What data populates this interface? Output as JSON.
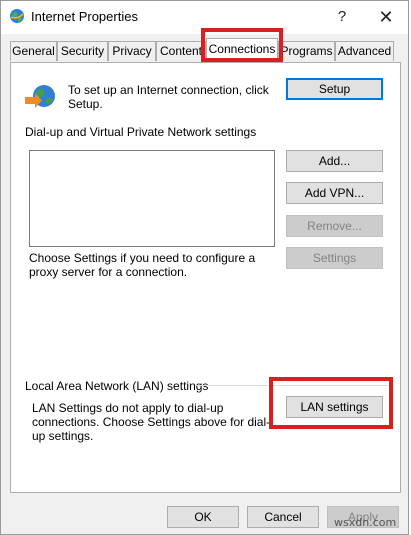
{
  "window": {
    "title": "Internet Properties",
    "help_glyph": "?",
    "close_glyph": "✕"
  },
  "tabs": [
    {
      "label": "General",
      "active": false
    },
    {
      "label": "Security",
      "active": false
    },
    {
      "label": "Privacy",
      "active": false
    },
    {
      "label": "Content",
      "active": false
    },
    {
      "label": "Connections",
      "active": true
    },
    {
      "label": "Programs",
      "active": false
    },
    {
      "label": "Advanced",
      "active": false
    }
  ],
  "setup": {
    "text": "To set up an Internet connection, click Setup.",
    "button": "Setup"
  },
  "dialup": {
    "heading": "Dial-up and Virtual Private Network settings",
    "add_button": "Add...",
    "add_vpn_button": "Add VPN...",
    "remove_button": "Remove...",
    "settings_button": "Settings",
    "proxy_text": "Choose Settings if you need to configure a proxy server for a connection."
  },
  "lan": {
    "heading": "Local Area Network (LAN) settings",
    "text": "LAN Settings do not apply to dial-up connections. Choose Settings above for dial-up settings.",
    "button": "LAN settings"
  },
  "footer": {
    "ok": "OK",
    "cancel": "Cancel",
    "apply": "Apply"
  },
  "watermark": "wsxdn.com",
  "colors": {
    "highlight_box": "#d9201f",
    "default_button_border": "#0078d7",
    "disabled_text": "#838383"
  },
  "icons": {
    "app": "internet-globe-icon",
    "connection": "globe-connection-icon"
  }
}
